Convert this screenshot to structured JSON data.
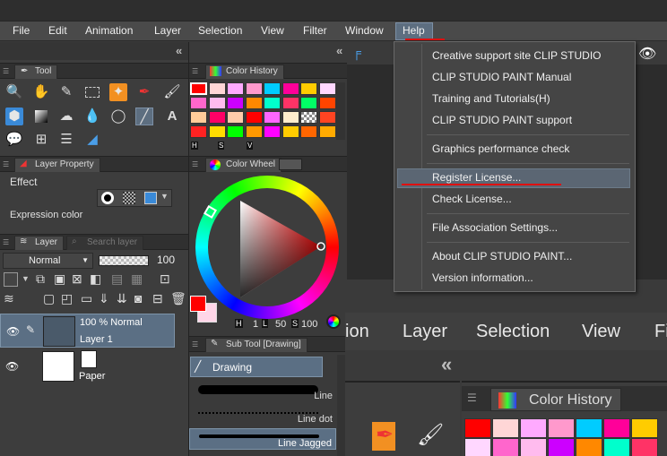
{
  "menubar": {
    "items": [
      "File",
      "Edit",
      "Animation",
      "Layer",
      "Selection",
      "View",
      "Filter",
      "Window",
      "Help"
    ],
    "active": "Help"
  },
  "panels": {
    "tool": {
      "title": "Tool"
    },
    "layer_property": {
      "title": "Layer Property",
      "effect_label": "Effect",
      "expression_label": "Expression color"
    },
    "layer": {
      "title": "Layer",
      "search_tab": "Search layer",
      "blend_mode": "Normal",
      "opacity": "100",
      "layers": [
        {
          "mode": "100 % Normal",
          "name": "Layer 1"
        },
        {
          "mode": "",
          "name": "Paper"
        }
      ]
    },
    "color_history": {
      "title": "Color History",
      "labels": [
        "H",
        "S",
        "V"
      ],
      "colors": [
        "#ff0000",
        "#ffd6d6",
        "#ffaaff",
        "#ff99cc",
        "#00ccff",
        "#ff0099",
        "#ffcc00",
        "#ffd7ff",
        "#ff66cc",
        "#ffbbee",
        "#cc00ff",
        "#ff8800",
        "#00ffcc",
        "#ff3366",
        "#00ff66",
        "#ff4400",
        "#ffcc99",
        "#ff0066",
        "#ffccaa",
        "#ff0000",
        "#ff66ff",
        "#ffeecc",
        "#cccccc",
        "#ff4422",
        "#ff2222",
        "#ffdd00",
        "#00ff00",
        "#ff9900",
        "#ff00ff",
        "#ffcc00",
        "#ff6600",
        "#ffaa00"
      ]
    },
    "color_wheel": {
      "title": "Color Wheel",
      "readout": {
        "h_label": "H",
        "h_value": "1",
        "l_label": "L",
        "l_value": "50",
        "s_label": "S",
        "s_value": "100"
      },
      "main_color": "#ff0000",
      "sub_color": "#ffd6e8"
    },
    "sub_tool": {
      "title": "Sub Tool [Drawing]",
      "group": "Drawing",
      "items": [
        "Line",
        "Line dot",
        "Line Jagged"
      ]
    },
    "lower_color_history": {
      "title": "Color History"
    }
  },
  "help_menu": {
    "items": [
      "Creative support site CLIP STUDIO",
      "CLIP STUDIO PAINT Manual",
      "Training and Tutorials(H)",
      "CLIP STUDIO PAINT support",
      "Graphics performance check",
      "Register License...",
      "Check License...",
      "File Association Settings...",
      "About CLIP STUDIO PAINT...",
      "Version information..."
    ],
    "highlighted": "Register License..."
  },
  "lower_menubar": {
    "items": [
      "ion",
      "Layer",
      "Selection",
      "View",
      "Fi"
    ]
  },
  "colors": {
    "accent": "#5b6673",
    "annotation_red": "#e01010",
    "menu_bg": "#454545"
  }
}
